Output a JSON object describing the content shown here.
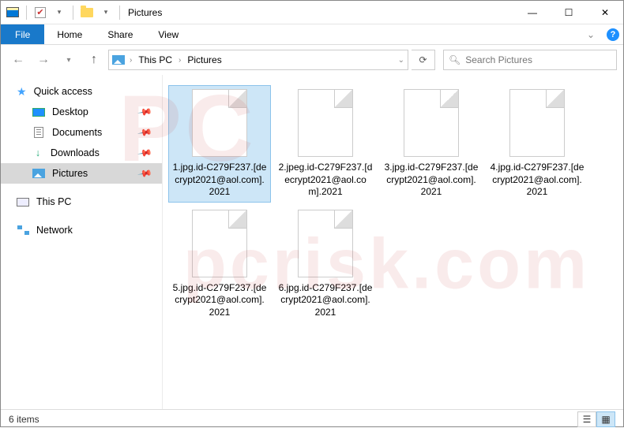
{
  "titlebar": {
    "title": "Pictures"
  },
  "window_controls": {
    "min": "—",
    "max": "☐",
    "close": "✕"
  },
  "ribbon": {
    "file": "File",
    "tabs": [
      "Home",
      "Share",
      "View"
    ]
  },
  "nav": {
    "breadcrumbs": [
      "This PC",
      "Pictures"
    ],
    "dropdown_caret": "⌄",
    "refresh": "⟳",
    "search": {
      "placeholder": "Search Pictures"
    }
  },
  "sidebar": {
    "quick_access": "Quick access",
    "items": [
      {
        "label": "Desktop",
        "pinned": true
      },
      {
        "label": "Documents",
        "pinned": true
      },
      {
        "label": "Downloads",
        "pinned": true
      },
      {
        "label": "Pictures",
        "pinned": true,
        "selected": true
      }
    ],
    "this_pc": "This PC",
    "network": "Network"
  },
  "files": [
    {
      "name": "1.jpg.id-C279F237.[decrypt2021@aol.com].2021",
      "selected": true
    },
    {
      "name": "2.jpeg.id-C279F237.[decrypt2021@aol.com].2021",
      "selected": false
    },
    {
      "name": "3.jpg.id-C279F237.[decrypt2021@aol.com].2021",
      "selected": false
    },
    {
      "name": "4.jpg.id-C279F237.[decrypt2021@aol.com].2021",
      "selected": false
    },
    {
      "name": "5.jpg.id-C279F237.[decrypt2021@aol.com].2021",
      "selected": false
    },
    {
      "name": "6.jpg.id-C279F237.[decrypt2021@aol.com].2021",
      "selected": false
    }
  ],
  "statusbar": {
    "count": "6 items"
  },
  "watermark": "pcrisk.com"
}
